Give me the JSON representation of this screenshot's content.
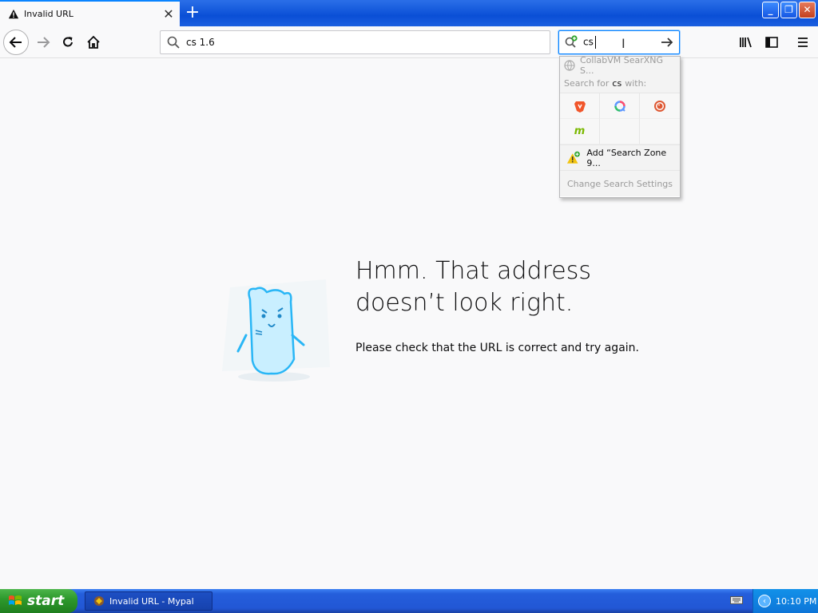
{
  "tab": {
    "title": "Invalid URL"
  },
  "window_controls": {
    "minimize": "_",
    "maximize": "❐",
    "close": "✕"
  },
  "address_bar": {
    "value": "cs 1.6"
  },
  "search_bar": {
    "value": "cs"
  },
  "search_popup": {
    "suggestion": "CollabVM SearXNG S...",
    "search_for_prefix": "Search for",
    "search_for_term": "cs",
    "search_for_suffix": "with:",
    "engines": [
      "brave-icon",
      "qwant-icon",
      "duckduckgo-icon",
      "mojeek-icon",
      "",
      ""
    ],
    "mojeek_glyph": "m",
    "add_engine": "Add “Search Zone 9...",
    "change_settings": "Change Search Settings"
  },
  "error": {
    "title_line1": "Hmm. That address",
    "title_line2": "doesn’t look right.",
    "description": "Please check that the URL is correct and try again."
  },
  "taskbar": {
    "start_label": "start",
    "task_label": "Invalid URL - Mypal",
    "clock": "10:10 PM"
  },
  "colors": {
    "accent": "#0a84ff",
    "taskbar": "#245edb",
    "start": "#2e9a2d"
  }
}
